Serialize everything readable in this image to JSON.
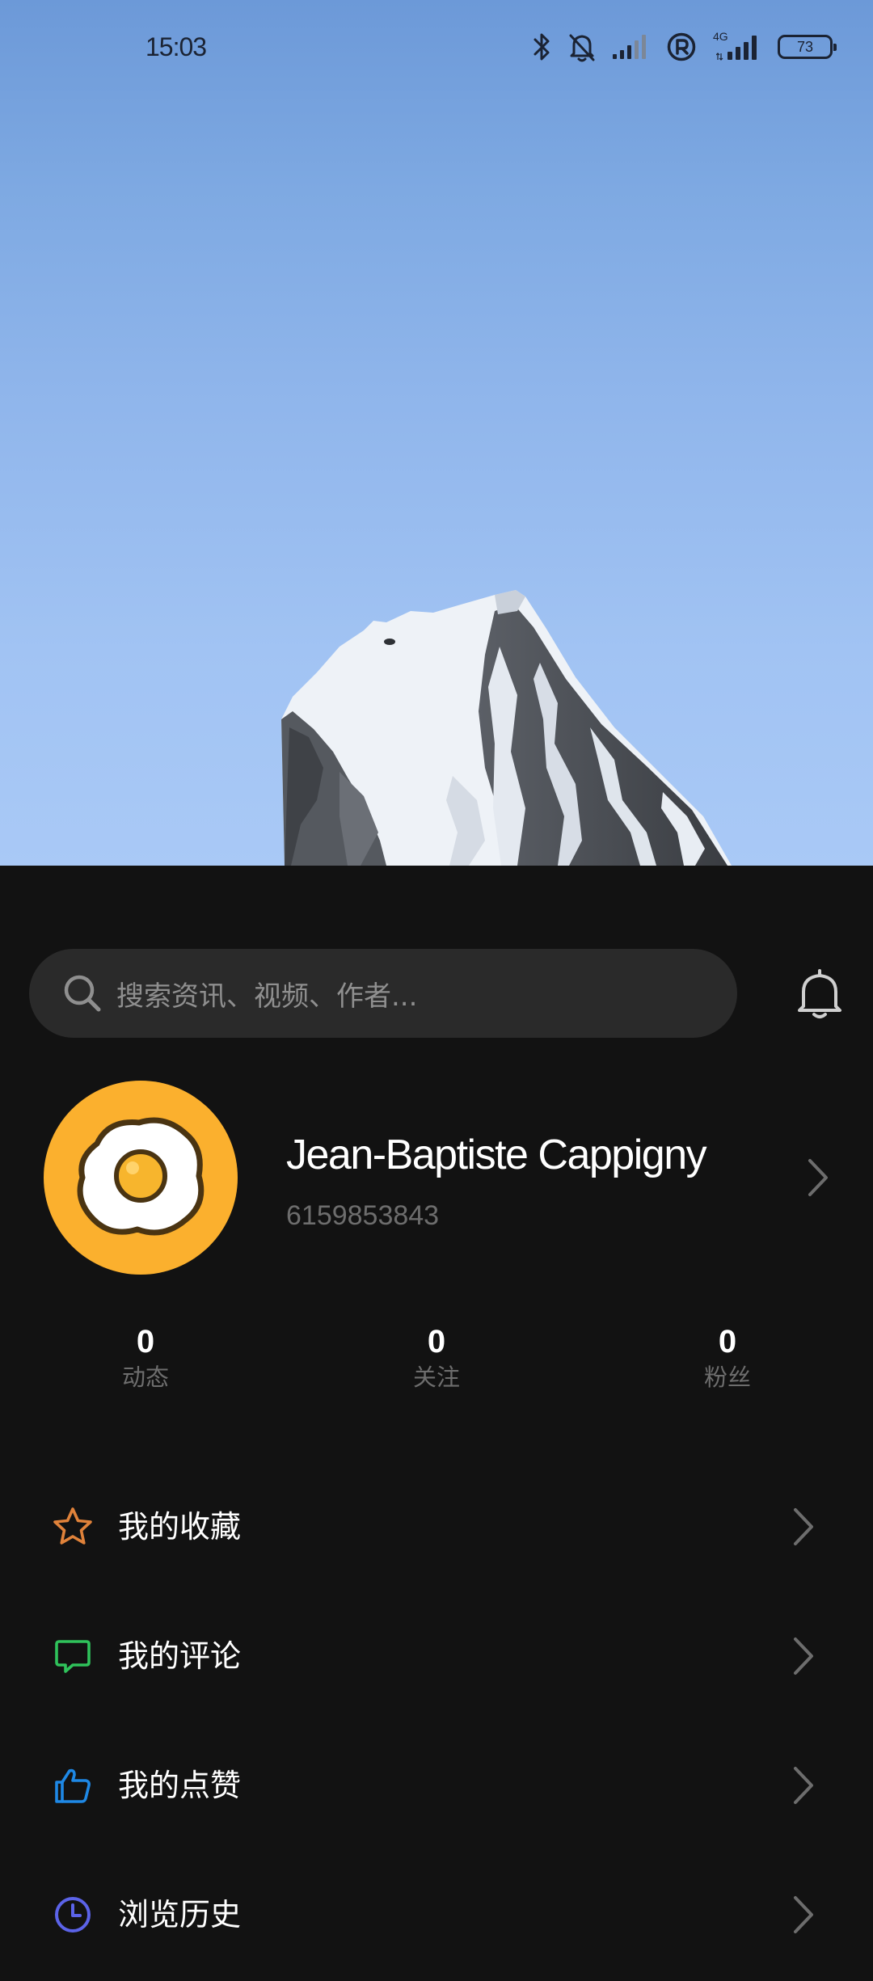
{
  "status_bar": {
    "time": "15:03",
    "network": "4G",
    "battery": "73",
    "icons": [
      "bluetooth-icon",
      "bell-muted-icon",
      "signal-icon",
      "registered-icon",
      "signal-4g-icon",
      "battery-icon"
    ]
  },
  "search": {
    "placeholder": "搜索资讯、视频、作者..."
  },
  "profile": {
    "name": "Jean-Baptiste Cappigny",
    "id": "6159853843"
  },
  "stats": [
    {
      "value": "0",
      "label": "动态"
    },
    {
      "value": "0",
      "label": "关注"
    },
    {
      "value": "0",
      "label": "粉丝"
    }
  ],
  "menu": [
    {
      "label": "我的收藏",
      "icon": "star-icon",
      "color": "#e0823a"
    },
    {
      "label": "我的评论",
      "icon": "comment-icon",
      "color": "#2fc25b"
    },
    {
      "label": "我的点赞",
      "icon": "thumbs-up-icon",
      "color": "#1e88e5"
    },
    {
      "label": "浏览历史",
      "icon": "clock-icon",
      "color": "#5b63e8"
    }
  ],
  "colors": {
    "panel_background": "#121212",
    "search_background": "#2a2a2a",
    "avatar_background": "#fbb02e",
    "secondary_text": "#6d6d6d"
  }
}
